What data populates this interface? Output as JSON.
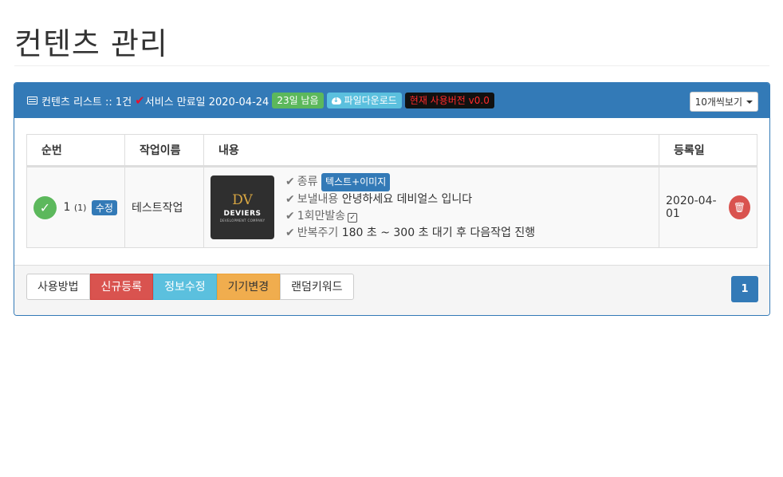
{
  "page": {
    "title": "컨텐츠 관리"
  },
  "panel": {
    "heading": "컨텐츠 리스트 :: 1건",
    "service_expiry": "서비스 만료일 2020-04-24",
    "days_left": "23일 남음",
    "download_label": "파일다운로드",
    "version_label": "현재 사용버전 v0.0",
    "page_size_label": "10개씩보기",
    "colors": {
      "primary": "#337ab7",
      "success": "#5cb85c",
      "info": "#5bc0de",
      "danger": "#d9534f",
      "warning": "#f0ad4e"
    }
  },
  "table": {
    "headers": {
      "no": "순번",
      "job": "작업이름",
      "content": "내용",
      "date": "등록일"
    },
    "rows": [
      {
        "no": "1",
        "sub": "(1)",
        "edit_label": "수정",
        "job_name": "테스트작업",
        "logo": {
          "mark": "DV",
          "name": "DEVIERS",
          "sub": "DEVELOPMENT COMPANY"
        },
        "type_label": "종류",
        "type_value": "텍스트+이미지",
        "message_label": "보낼내용",
        "message_value": "안녕하세요 데비얼스 입니다",
        "once_label": "1회만발송",
        "cycle_label": "반복주기",
        "cycle_value": "180 초 ~ 300 초 대기 후 다음작업 진행",
        "date": "2020-04-01"
      }
    ]
  },
  "footer": {
    "buttons": [
      "사용방법",
      "신규등록",
      "정보수정",
      "기기변경",
      "랜덤키워드"
    ],
    "page": "1"
  }
}
